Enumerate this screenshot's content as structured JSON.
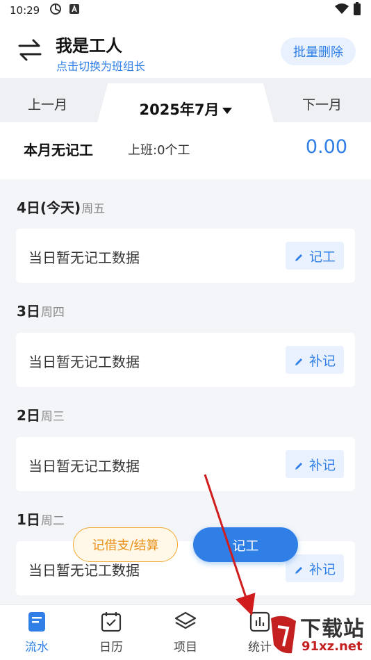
{
  "status_bar": {
    "time": "10:29",
    "battery_glyph": "⚡"
  },
  "header": {
    "role_title": "我是工人",
    "role_subtitle": "点击切换为班组长",
    "batch_delete_label": "批量删除"
  },
  "month_nav": {
    "prev_label": "上一月",
    "current_label": "2025年7月",
    "next_label": "下一月"
  },
  "summary": {
    "title": "本月无记工",
    "work_label": "上班:0个工",
    "amount": "0.00"
  },
  "days": [
    {
      "day_label": "4日(今天)",
      "weekday": "周五",
      "empty_text": "当日暂无记工数据",
      "action_label": "记工"
    },
    {
      "day_label": "3日",
      "weekday": "周四",
      "empty_text": "当日暂无记工数据",
      "action_label": "补记"
    },
    {
      "day_label": "2日",
      "weekday": "周三",
      "empty_text": "当日暂无记工数据",
      "action_label": "补记"
    },
    {
      "day_label": "1日",
      "weekday": "周二",
      "empty_text": "当日暂无记工数据",
      "action_label": "补记"
    }
  ],
  "fab": {
    "loan_label": "记借支/结算",
    "record_label": "记工"
  },
  "bottom_nav": [
    {
      "label": "流水",
      "icon": "list-doc-icon",
      "active": true
    },
    {
      "label": "日历",
      "icon": "calendar-icon",
      "active": false
    },
    {
      "label": "项目",
      "icon": "layers-icon",
      "active": false
    },
    {
      "label": "统计",
      "icon": "chart-icon",
      "active": false
    }
  ],
  "watermark": {
    "brand_text": "下载站",
    "domain_text": "91xz.net"
  },
  "colors": {
    "accent": "#2f7fe6",
    "orange": "#e8921a",
    "arrow": "#d01c1c"
  }
}
